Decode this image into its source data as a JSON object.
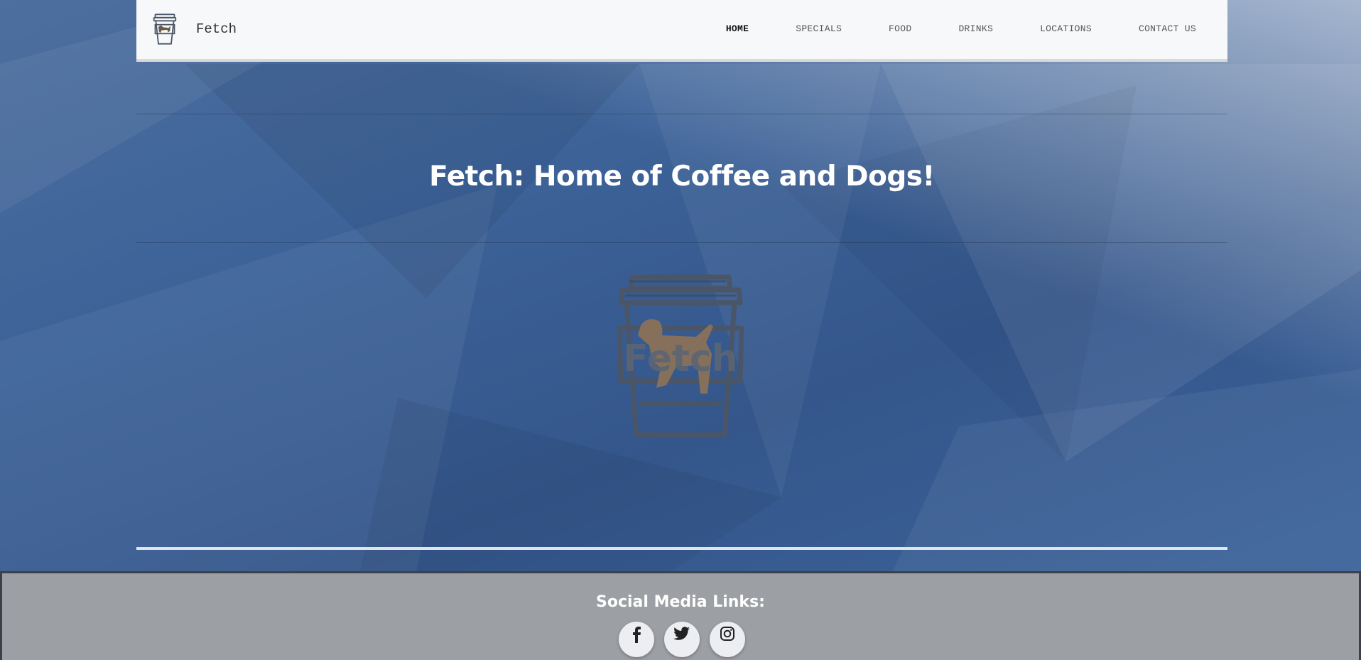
{
  "brand": {
    "name": "Fetch",
    "logo_icon": "fetch-cup-logo-icon"
  },
  "nav": {
    "items": [
      {
        "label": "HOME",
        "active": true
      },
      {
        "label": "SPECIALS",
        "active": false
      },
      {
        "label": "FOOD",
        "active": false
      },
      {
        "label": "DRINKS",
        "active": false
      },
      {
        "label": "LOCATIONS",
        "active": false
      },
      {
        "label": "CONTACT US",
        "active": false
      }
    ]
  },
  "hero": {
    "title": "Fetch: Home of Coffee and Dogs!",
    "logo_text": "Fetch",
    "logo_icon": "fetch-cup-logo-icon"
  },
  "footer": {
    "title": "Social Media Links:",
    "links": [
      {
        "icon": "facebook-icon"
      },
      {
        "icon": "twitter-icon"
      },
      {
        "icon": "instagram-icon"
      }
    ]
  },
  "colors": {
    "navbar_bg": "#f7f8fa",
    "page_bg": "#3d6399",
    "footer_bg": "#9c9fa4",
    "logo_dog": "#8a7258",
    "logo_outline": "#4a5668"
  }
}
